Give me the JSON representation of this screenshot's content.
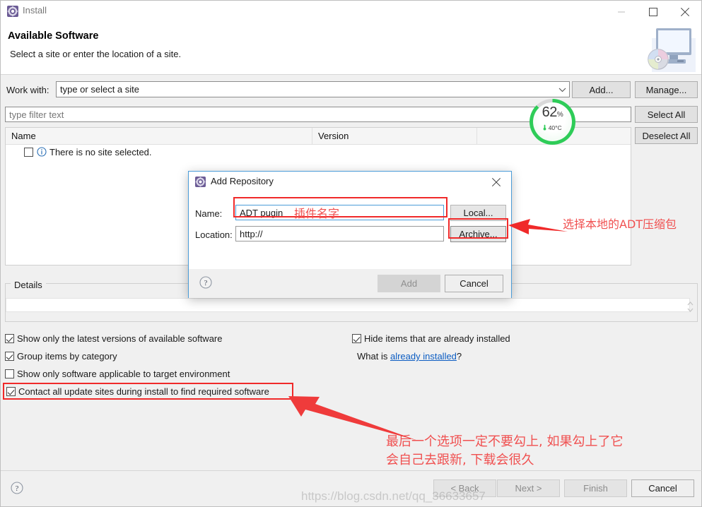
{
  "window": {
    "title": "Install",
    "icon": "eclipse-install-icon",
    "controls": {
      "minimize": "minimize-icon",
      "maximize": "maximize-icon",
      "close": "close-icon"
    }
  },
  "header": {
    "title": "Available Software",
    "subtitle": "Select a site or enter the location of a site.",
    "banner_icon": "monitor-with-disc-icon"
  },
  "work_with": {
    "label": "Work with:",
    "value": "type or select a site",
    "dropdown_icon": "chevron-down-icon",
    "add_button": "Add...",
    "manage_button": "Manage..."
  },
  "filter": {
    "placeholder": "type filter text",
    "value": ""
  },
  "tree": {
    "columns": [
      "Name",
      "Version"
    ],
    "rows": [
      {
        "checked": false,
        "icon": "info-icon",
        "name": "There is no site selected.",
        "version": ""
      }
    ]
  },
  "side_buttons": {
    "select_all": "Select All",
    "deselect_all": "Deselect All"
  },
  "details": {
    "legend": "Details",
    "value": "",
    "spinner_icon": "up-down-arrows-icon"
  },
  "options": {
    "left": [
      {
        "label": "Show only the latest versions of available software",
        "checked": true
      },
      {
        "label": "Group items by category",
        "checked": true
      },
      {
        "label": "Show only software applicable to target environment",
        "checked": false
      },
      {
        "label": "Contact all update sites during install to find required software",
        "checked": true
      }
    ],
    "right": [
      {
        "label": "Hide items that are already installed",
        "checked": true
      }
    ],
    "what_is_prefix": "What is ",
    "what_is_link": "already installed",
    "what_is_suffix": "?"
  },
  "footer": {
    "help_icon": "help-question-icon",
    "buttons": [
      {
        "label": "< Back",
        "enabled": false
      },
      {
        "label": "Next >",
        "enabled": false
      },
      {
        "label": "Finish",
        "enabled": false
      },
      {
        "label": "Cancel",
        "enabled": true
      }
    ]
  },
  "gauge": {
    "percent": "62",
    "percent_unit": "%",
    "temperature": "40°C",
    "thermometer_icon": "thermometer-icon",
    "ring_color": "#2ecc58",
    "value": 62
  },
  "dialog": {
    "title": "Add Repository",
    "icon": "eclipse-install-icon",
    "close_icon": "close-icon",
    "name_label": "Name:",
    "name_value": "ADT pugin",
    "location_label": "Location:",
    "location_value": "http://",
    "local_button": "Local...",
    "archive_button": "Archive...",
    "help_icon": "help-question-icon",
    "add_button": "Add",
    "cancel_button": "Cancel"
  },
  "annotations": {
    "name_note": "插件名字",
    "archive_note": "选择本地的ADT压缩包",
    "bottom_note_line1": "最后一个选项一定不要勾上, 如果勾上了它",
    "bottom_note_line2": "会自己去跟新, 下载会很久",
    "color": "#f05050",
    "box_color": "#f02a2a"
  },
  "watermark": "https://blog.csdn.net/qq_36633657"
}
